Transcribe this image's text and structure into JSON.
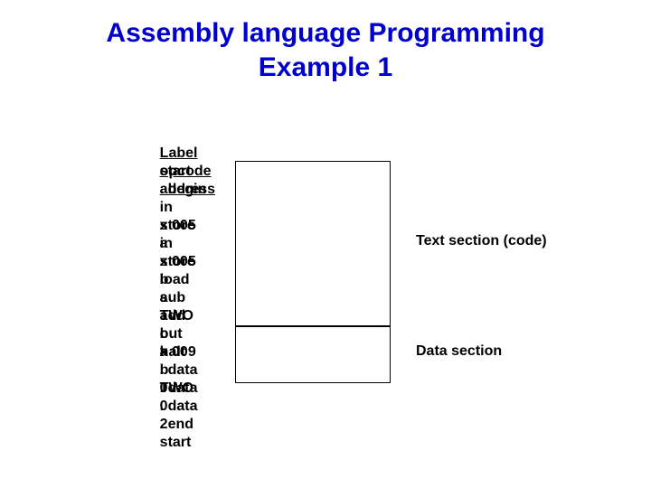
{
  "title_line1": "Assembly  language Programming",
  "title_line2": "Example 1",
  "headers": {
    "label": "Label",
    "opcode": "opcode",
    "address": "address"
  },
  "rows": [
    {
      "label": "start",
      "opcode": ". begin",
      "address": ""
    },
    {
      "label": "",
      "opcode": "in",
      "address": "x 005"
    },
    {
      "label": "",
      "opcode": "store",
      "address": "a"
    },
    {
      "label": "",
      "opcode": "in",
      "address": "x 005"
    },
    {
      "label": "",
      "opcode": "store",
      "address": "b"
    },
    {
      "label": "",
      "opcode": "load",
      "address": "a"
    },
    {
      "label": "",
      "opcode": "sub",
      "address": "TWO"
    },
    {
      "label": "",
      "opcode": "add",
      "address": "b"
    },
    {
      "label": "",
      "opcode": "out",
      "address": "x 009"
    },
    {
      "label": "",
      "opcode": "halt",
      "address": ""
    },
    {
      "label": "a",
      "opcode": ". data",
      "address": "0"
    },
    {
      "label": "b",
      "opcode": ". data",
      "address": "0"
    },
    {
      "label": "TWO",
      "opcode": ". data",
      "address": "2"
    },
    {
      "label": "",
      "opcode": ". end",
      "address": "start"
    }
  ],
  "annotations": {
    "code": "Text section (code)",
    "data": "Data section"
  }
}
